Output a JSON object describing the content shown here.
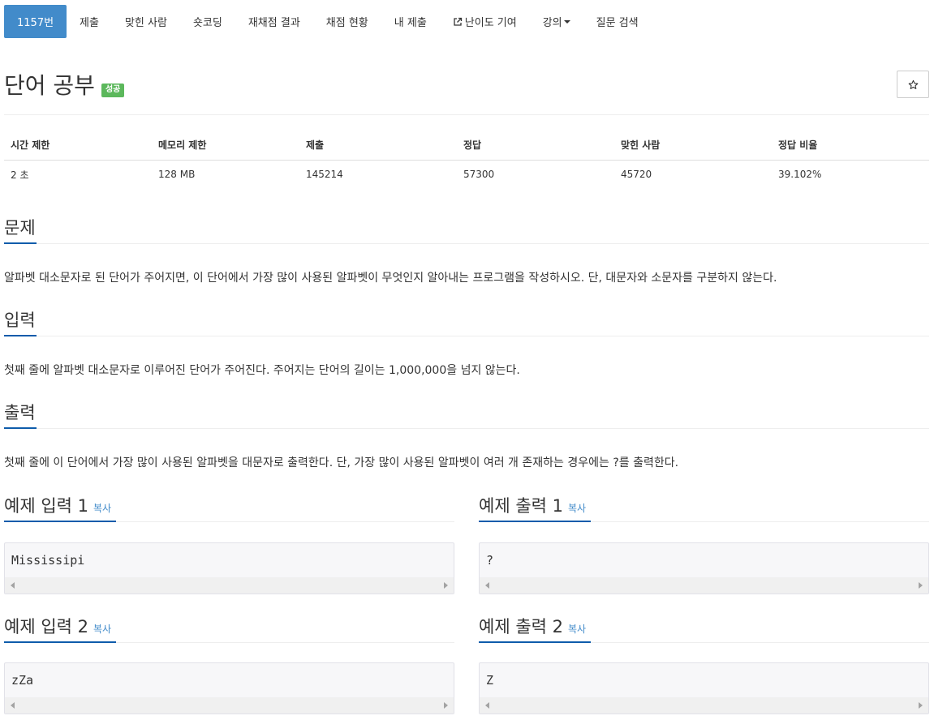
{
  "nav": {
    "items": [
      {
        "label": "1157번",
        "active": true
      },
      {
        "label": "제출"
      },
      {
        "label": "맞힌 사람"
      },
      {
        "label": "숏코딩"
      },
      {
        "label": "재채점 결과"
      },
      {
        "label": "채점 현황"
      },
      {
        "label": "내 제출"
      },
      {
        "label": "난이도 기여",
        "icon": "external-link-icon"
      },
      {
        "label": "강의",
        "icon": "caret-down-icon"
      },
      {
        "label": "질문 검색"
      }
    ]
  },
  "problem": {
    "title": "단어 공부",
    "status_badge": "성공",
    "star_icon": "star-outline-icon"
  },
  "info_table": {
    "headers": [
      "시간 제한",
      "메모리 제한",
      "제출",
      "정답",
      "맞힌 사람",
      "정답 비율"
    ],
    "values": [
      "2 초",
      "128 MB",
      "145214",
      "57300",
      "45720",
      "39.102%"
    ]
  },
  "sections": {
    "problem": {
      "title": "문제",
      "text": "알파벳 대소문자로 된 단어가 주어지면, 이 단어에서 가장 많이 사용된 알파벳이 무엇인지 알아내는 프로그램을 작성하시오. 단, 대문자와 소문자를 구분하지 않는다."
    },
    "input": {
      "title": "입력",
      "text": "첫째 줄에 알파벳 대소문자로 이루어진 단어가 주어진다. 주어지는 단어의 길이는 1,000,000을 넘지 않는다."
    },
    "output": {
      "title": "출력",
      "text": "첫째 줄에 이 단어에서 가장 많이 사용된 알파벳을 대문자로 출력한다. 단, 가장 많이 사용된 알파벳이 여러 개 존재하는 경우에는 ?를 출력한다."
    }
  },
  "samples": {
    "copy_label": "복사",
    "input1": {
      "title": "예제 입력 1",
      "content": "Mississipi"
    },
    "output1": {
      "title": "예제 출력 1",
      "content": "?"
    },
    "input2": {
      "title": "예제 입력 2",
      "content": "zZa"
    },
    "output2": {
      "title": "예제 출력 2",
      "content": "Z"
    }
  },
  "colors": {
    "nav_active": "#428bca",
    "badge_success": "#5cb85c",
    "link": "#428bca",
    "section_underline": "#0e5cab"
  }
}
